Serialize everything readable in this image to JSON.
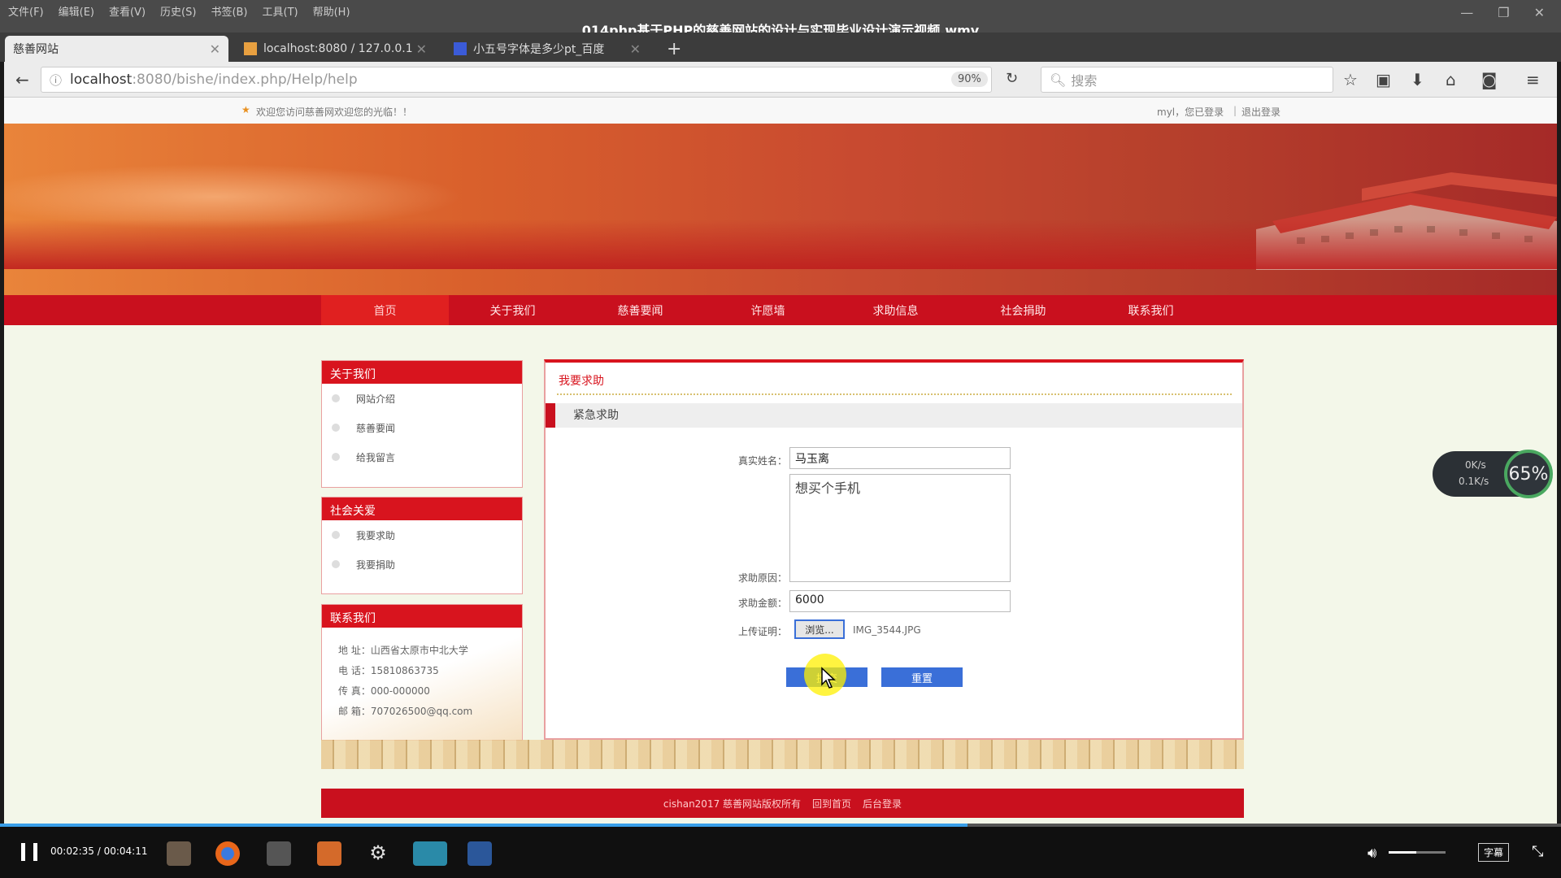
{
  "window": {
    "menu": [
      "文件(F)",
      "编辑(E)",
      "查看(V)",
      "历史(S)",
      "书签(B)",
      "工具(T)",
      "帮助(H)"
    ],
    "video_title": "014php基于PHP的慈善网站的设计与实现毕业设计演示视频.wmv"
  },
  "tabs": [
    {
      "label": "慈善网站"
    },
    {
      "label": "localhost:8080 / 127.0.0.1"
    },
    {
      "label": "小五号字体是多少pt_百度"
    }
  ],
  "address": {
    "host": "localhost",
    "rest": ":8080/bishe/index.php/Help/help",
    "zoom": "90%",
    "search_placeholder": "搜索"
  },
  "site": {
    "welcome": "欢迎您访问慈善网欢迎您的光临！！",
    "user_status": "myl，您已登录",
    "logout": "退出登录",
    "nav": [
      "首页",
      "关于我们",
      "慈善要闻",
      "许愿墙",
      "求助信息",
      "社会捐助",
      "联系我们"
    ],
    "sidebar": {
      "about_title": "关于我们",
      "about_items": [
        "网站介绍",
        "慈善要闻",
        "给我留言"
      ],
      "social_title": "社会关爱",
      "social_items": [
        "我要求助",
        "我要捐助"
      ],
      "contact_title": "联系我们",
      "contact_lines": [
        "地 址：山西省太原市中北大学",
        "电 话：15810863735",
        "传 真：000-000000",
        "邮 箱：707026500@qq.com"
      ]
    },
    "form": {
      "panel_title": "我要求助",
      "section_title": "紧急求助",
      "name_label": "真实姓名：",
      "name_value": "马玉离",
      "reason_label": "求助原因：",
      "reason_value": "想买个手机",
      "amount_label": "求助金额：",
      "amount_value": "6000",
      "upload_label": "上传证明：",
      "browse_button": "浏览...",
      "file_name": "IMG_3544.JPG",
      "submit_button": "提交",
      "reset_button": "重置"
    },
    "footer": {
      "copyright": "cishan2017 慈善网站版权所有",
      "home_link": "回到首页",
      "admin_link": "后台登录"
    }
  },
  "player": {
    "time": "00:02:35 / 00:04:11",
    "progress": 0.62,
    "subtitle_btn": "字幕"
  },
  "net_widget": {
    "up": "0K/s",
    "down": "0.1K/s",
    "percent": "65%"
  }
}
